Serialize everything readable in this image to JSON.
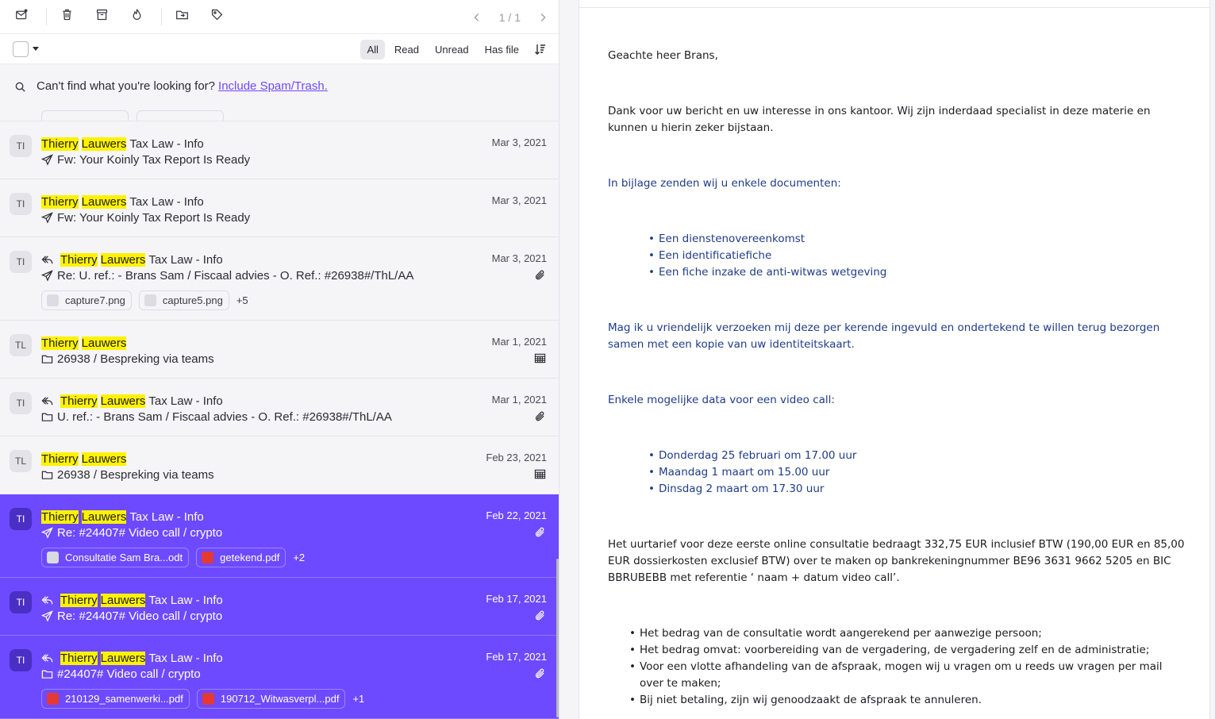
{
  "toolbar": {
    "pager": "1 / 1"
  },
  "filters": [
    "All",
    "Read",
    "Unread",
    "Has file"
  ],
  "active_filter": "All",
  "hint": {
    "text": "Can't find what you're looking for?",
    "link": "Include Spam/Trash."
  },
  "messages": [
    {
      "avatar": "TI",
      "first": "Thierry",
      "last": "Lauwers",
      "rest": "Tax Law - Info",
      "replied": false,
      "subject_icon": "sent-icon",
      "subject": "Fw: Your Koinly Tax Report Is Ready",
      "date": "Mar 3, 2021",
      "trail_icon": "",
      "attachments": [],
      "more": "",
      "selected": false
    },
    {
      "avatar": "TI",
      "first": "Thierry",
      "last": "Lauwers",
      "rest": "Tax Law - Info",
      "replied": false,
      "subject_icon": "sent-icon",
      "subject": "Fw: Your Koinly Tax Report Is Ready",
      "date": "Mar 3, 2021",
      "trail_icon": "",
      "attachments": [],
      "more": "",
      "selected": false
    },
    {
      "avatar": "TI",
      "first": "Thierry",
      "last": "Lauwers",
      "rest": "Tax Law - Info",
      "replied": true,
      "subject_icon": "sent-icon",
      "subject": "Re: U. ref.: - Brans Sam / Fiscaal advies - O. Ref.: #26938#/ThL/AA",
      "date": "Mar 3, 2021",
      "trail_icon": "paperclip-icon",
      "attachments": [
        {
          "name": "capture7.png",
          "type": "img"
        },
        {
          "name": "capture5.png",
          "type": "img"
        }
      ],
      "more": "+5",
      "selected": false
    },
    {
      "avatar": "TL",
      "first": "Thierry",
      "last": "Lauwers",
      "rest": "",
      "replied": false,
      "subject_icon": "folder-icon",
      "subject": "26938 / Bespreking via teams",
      "date": "Mar 1, 2021",
      "trail_icon": "calendar-icon",
      "attachments": [],
      "more": "",
      "selected": false
    },
    {
      "avatar": "TI",
      "first": "Thierry",
      "last": "Lauwers",
      "rest": "Tax Law - Info",
      "replied": true,
      "subject_icon": "folder-icon",
      "subject": "U. ref.: - Brans Sam / Fiscaal advies - O. Ref.: #26938#/ThL/AA",
      "date": "Mar 1, 2021",
      "trail_icon": "paperclip-icon",
      "attachments": [],
      "more": "",
      "selected": false
    },
    {
      "avatar": "TL",
      "first": "Thierry",
      "last": "Lauwers",
      "rest": "",
      "replied": false,
      "subject_icon": "folder-icon",
      "subject": "26938 / Bespreking via teams",
      "date": "Feb 23, 2021",
      "trail_icon": "calendar-icon",
      "attachments": [],
      "more": "",
      "selected": false
    },
    {
      "avatar": "TI",
      "first": "Thierry",
      "last": "Lauwers",
      "rest": "Tax Law - Info",
      "replied": false,
      "subject_icon": "sent-icon",
      "subject": "Re: #24407# Video call / crypto",
      "date": "Feb 22, 2021",
      "trail_icon": "paperclip-icon",
      "attachments": [
        {
          "name": "Consultatie Sam Bra...odt",
          "type": "doc"
        },
        {
          "name": "getekend.pdf",
          "type": "pdf"
        }
      ],
      "more": "+2",
      "selected": true
    },
    {
      "avatar": "TI",
      "first": "Thierry",
      "last": "Lauwers",
      "rest": "Tax Law - Info",
      "replied": true,
      "subject_icon": "sent-icon",
      "subject": "Re: #24407# Video call / crypto",
      "date": "Feb 17, 2021",
      "trail_icon": "paperclip-icon",
      "attachments": [],
      "more": "",
      "selected": true
    },
    {
      "avatar": "TI",
      "first": "Thierry",
      "last": "Lauwers",
      "rest": "Tax Law - Info",
      "replied": true,
      "subject_icon": "folder-icon",
      "subject": "#24407# Video call / crypto",
      "date": "Feb 17, 2021",
      "trail_icon": "paperclip-icon",
      "attachments": [
        {
          "name": "210129_samenwerki...pdf",
          "type": "pdf"
        },
        {
          "name": "190712_Witwasverpl...pdf",
          "type": "pdf"
        }
      ],
      "more": "+1",
      "selected": true
    }
  ],
  "email": {
    "greeting": "Geachte heer Brans,",
    "intro": "Dank voor uw bericht en uw interesse in ons kantoor. Wij zijn inderdaad specialist in deze materie en kunnen u hierin zeker bijstaan.",
    "attachments_intro": "In bijlage zenden wij u enkele documenten:",
    "documents": [
      "Een dienstenovereenkomst",
      "Een identificatiefiche",
      "Een fiche inzake de anti-witwas wetgeving"
    ],
    "request": "Mag ik u vriendelijk verzoeken mij deze per kerende ingevuld en ondertekend te willen terug bezorgen samen met een kopie van uw identiteitskaart.",
    "dates_intro": "Enkele mogelijke data voor een video call:",
    "dates": [
      "Donderdag 25 februari om 17.00 uur",
      "Maandag 1 maart om 15.00 uur",
      "Dinsdag 2 maart om 17.30 uur"
    ],
    "rate": "Het uurtarief voor deze eerste online consultatie bedraagt 332,75 EUR inclusief BTW (190,00 EUR en 85,00 EUR dossierkosten exclusief BTW) over te maken op bankrekeningnummer BE96 3631 9662 5205  en BIC BBRUBEBB met referentie ‘ naam + datum video call’.",
    "terms": [
      "Het bedrag van de consultatie wordt aangerekend per aanwezige persoon;",
      "Het bedrag omvat: voorbereiding van de vergadering, de vergadering zelf en de administratie;",
      "Voor een vlotte afhandeling van de afspraak, mogen wij u vragen om u reeds uw vragen per mail over te maken;",
      "Bij niet betaling, zijn wij genoodzaakt de afspraak te annuleren."
    ]
  },
  "colors": {
    "accent": "#6d4aff",
    "highlight": "#fff200",
    "link_blue": "#1f3c88"
  }
}
